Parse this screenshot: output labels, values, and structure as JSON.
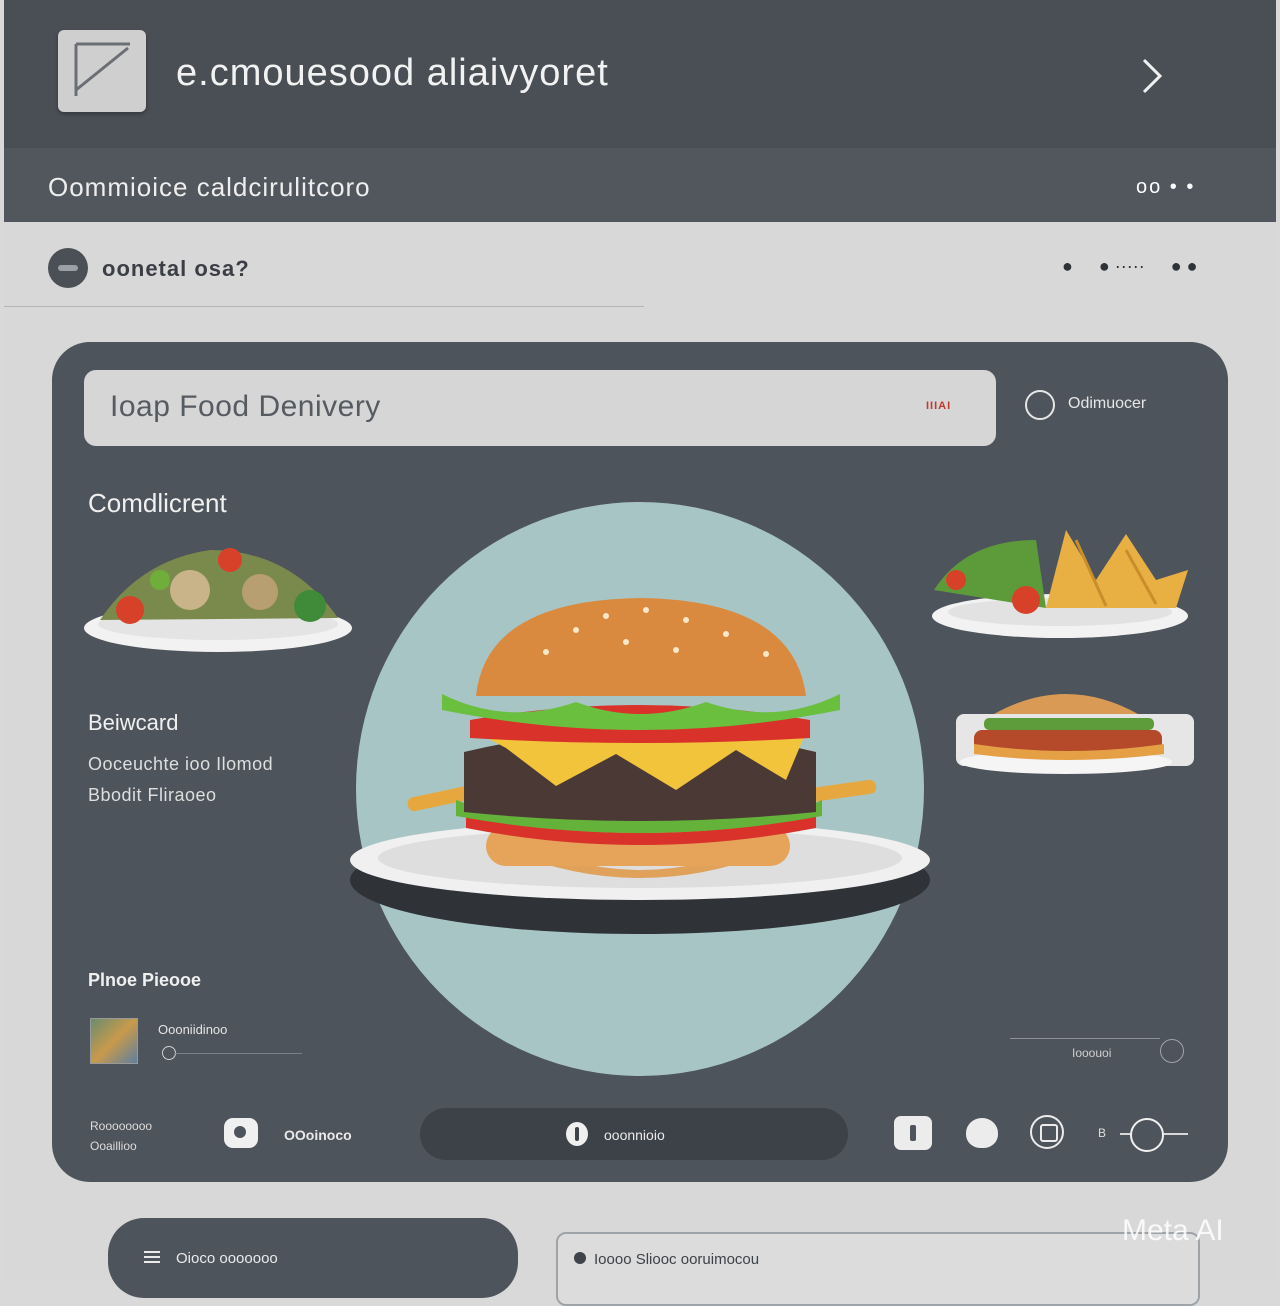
{
  "header": {
    "app_title": "e.cmouesood aliaivyoret"
  },
  "subheader": {
    "title": "Oommioice caldcirulitcoro",
    "dots": "oo • •"
  },
  "section": {
    "user_label": "oonetal osa?"
  },
  "search": {
    "value": "Ioap Food Denivery",
    "badge": "IIIAI"
  },
  "filter": {
    "label": "Odimuocer"
  },
  "main": {
    "category_heading": "Comdlicrent",
    "featured_heading": "Beiwcard",
    "featured_lines": [
      "Ooceuchte ioo Ilomod",
      "Bbodit Fliraoeo"
    ],
    "price_heading": "Plnoe Pieooe",
    "thumb_label": "Oooniidinoo",
    "right_info_label": "Iooouoi"
  },
  "footer_bar": {
    "left_text_1": "Roooooooo",
    "left_text_2": "Ooaillioo",
    "camera_label": "OOoinoco",
    "center_label": "ooonnioio",
    "toggle_label": "B"
  },
  "bottom": {
    "left_label": "Oioco ooooooo",
    "right_label": "Ioooo Sliooc ooruimocou"
  },
  "watermark": "Meta AI",
  "colors": {
    "header_bg": "#4a4f55",
    "card_bg": "#4e545b",
    "accent_circle": "#a8c5c6",
    "badge_red": "#c0392b"
  },
  "icons": {
    "logo": "diagonal-arrow-box",
    "next": "chevron-right-icon",
    "filter": "circle-icon",
    "camera": "camera-icon",
    "info": "info-icon"
  }
}
